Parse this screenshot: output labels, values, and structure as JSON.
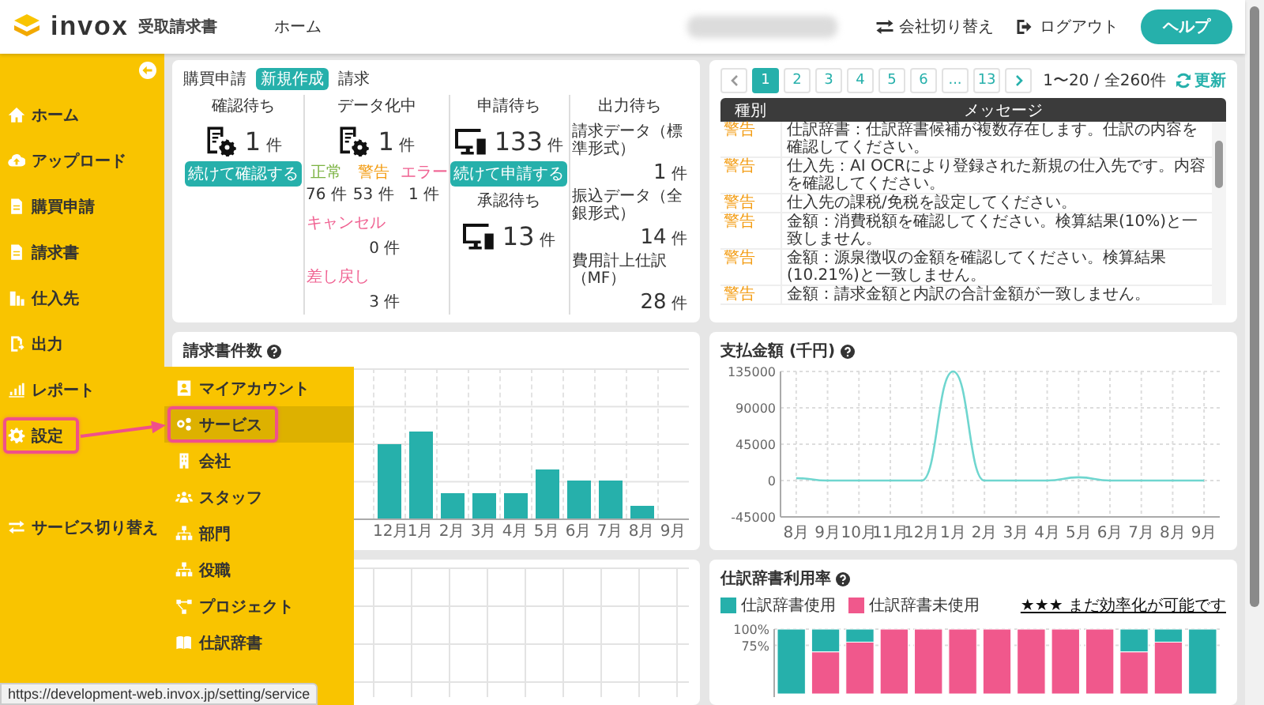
{
  "header": {
    "logo": "invox",
    "product": "受取請求書",
    "nav": [
      {
        "label": "ホーム"
      }
    ],
    "actions": [
      {
        "kind": "switch",
        "label": "会社切り替え"
      },
      {
        "kind": "logout",
        "label": "ログアウト"
      }
    ],
    "help_button": "ヘルプ"
  },
  "sidebar": {
    "items": [
      {
        "kind": "home",
        "label": "ホーム",
        "highlighted": false
      },
      {
        "kind": "upload",
        "label": "アップロード",
        "highlighted": false
      },
      {
        "kind": "doc",
        "label": "購買申請",
        "highlighted": false
      },
      {
        "kind": "doc",
        "label": "請求書",
        "highlighted": false
      },
      {
        "kind": "supplier",
        "label": "仕入先",
        "highlighted": false
      },
      {
        "kind": "output",
        "label": "出力",
        "highlighted": false
      },
      {
        "kind": "report",
        "label": "レポート",
        "highlighted": false
      },
      {
        "kind": "settings",
        "label": "設定",
        "highlighted": true
      },
      {
        "kind": "switch",
        "label": "サービス切り替え",
        "highlighted": false
      }
    ]
  },
  "submenu": {
    "items": [
      {
        "kind": "user",
        "label": "マイアカウント",
        "selected": false,
        "highlighted": false
      },
      {
        "kind": "gears",
        "label": "サービス",
        "selected": true,
        "highlighted": true
      },
      {
        "kind": "building",
        "label": "会社",
        "selected": false,
        "highlighted": false
      },
      {
        "kind": "people",
        "label": "スタッフ",
        "selected": false,
        "highlighted": false
      },
      {
        "kind": "org",
        "label": "部門",
        "selected": false,
        "highlighted": false
      },
      {
        "kind": "org",
        "label": "役職",
        "selected": false,
        "highlighted": false
      },
      {
        "kind": "project",
        "label": "プロジェクト",
        "selected": false,
        "highlighted": false
      },
      {
        "kind": "book",
        "label": "仕訳辞書",
        "selected": false,
        "highlighted": false
      }
    ]
  },
  "summary": {
    "links": [
      {
        "kind": "link",
        "label": "購買申請"
      },
      {
        "kind": "badge",
        "label": "新規作成"
      },
      {
        "kind": "link",
        "label": "請求"
      }
    ],
    "columns": [
      {
        "title": "確認待ち",
        "blocks": [
          {
            "kind": "count-doc",
            "value": "1",
            "unit": "件"
          },
          {
            "kind": "button",
            "label": "続けて確認する"
          }
        ]
      },
      {
        "title": "データ化中",
        "blocks": [
          {
            "kind": "count-doc",
            "value": "1",
            "unit": "件"
          },
          {
            "kind": "statuses",
            "items": [
              {
                "label": "正常",
                "value": "76",
                "unit": "件",
                "color": "#7cb342"
              },
              {
                "label": "警告",
                "value": "53",
                "unit": "件",
                "color": "#f39c12"
              },
              {
                "label": "エラー",
                "value": "1",
                "unit": "件",
                "color": "#f06292"
              }
            ]
          },
          {
            "kind": "sub",
            "label": "キャンセル",
            "value": "0",
            "unit": "件"
          },
          {
            "kind": "sub",
            "label": "差し戻し",
            "value": "3",
            "unit": "件"
          }
        ]
      },
      {
        "title": "申請待ち",
        "blocks": [
          {
            "kind": "count-monitor",
            "value": "133",
            "unit": "件"
          },
          {
            "kind": "button",
            "label": "続けて申請する"
          },
          {
            "kind": "subtitle",
            "label": "承認待ち"
          },
          {
            "kind": "count-monitor",
            "value": "13",
            "unit": "件"
          }
        ]
      },
      {
        "title": "出力待ち",
        "blocks": [
          {
            "kind": "output",
            "label": "請求データ（標準形式）",
            "value": "1",
            "unit": "件"
          },
          {
            "kind": "output",
            "label": "振込データ（全銀形式）",
            "value": "14",
            "unit": "件"
          },
          {
            "kind": "output",
            "label": "費用計上仕訳（MF）",
            "value": "28",
            "unit": "件"
          }
        ]
      }
    ]
  },
  "messages": {
    "pages": [
      {
        "label": "1",
        "selected": true
      },
      {
        "label": "2",
        "selected": false
      },
      {
        "label": "3",
        "selected": false
      },
      {
        "label": "4",
        "selected": false
      },
      {
        "label": "5",
        "selected": false
      },
      {
        "label": "6",
        "selected": false
      },
      {
        "label": "...",
        "selected": false
      },
      {
        "label": "13",
        "selected": false
      }
    ],
    "range": "1〜20 / 全260件",
    "refresh": "更新",
    "columns": [
      "種別",
      "メッセージ"
    ],
    "rows": [
      {
        "type": "警告",
        "message": "仕訳辞書：仕訳辞書候補が複数存在します。仕訳の内容を確認してください。"
      },
      {
        "type": "警告",
        "message": "仕入先：AI OCRにより登録された新規の仕入先です。内容を確認してください。"
      },
      {
        "type": "警告",
        "message": "仕入先の課税/免税を設定してください。"
      },
      {
        "type": "警告",
        "message": "金額：消費税額を確認してください。検算結果(10%)と一致しません。"
      },
      {
        "type": "警告",
        "message": "金額：源泉徴収の金額を確認してください。検算結果(10.21%)と一致しません。"
      },
      {
        "type": "警告",
        "message": "金額：請求金額と内訳の合計金額が一致しません。"
      }
    ]
  },
  "invoice_count": {
    "title": "請求書件数",
    "bars": [
      {
        "label": "12月",
        "level": 0.5
      },
      {
        "label": "1月",
        "level": 0.58
      },
      {
        "label": "2月",
        "level": 0.17
      },
      {
        "label": "3月",
        "level": 0.17
      },
      {
        "label": "4月",
        "level": 0.17
      },
      {
        "label": "5月",
        "level": 0.33
      },
      {
        "label": "6月",
        "level": 0.25
      },
      {
        "label": "7月",
        "level": 0.25
      },
      {
        "label": "8月",
        "level": 0.08
      },
      {
        "label": "9月",
        "level": 0
      }
    ]
  },
  "payment_amount": {
    "title": "支払金額 (千円)",
    "chart_data": {
      "type": "line",
      "categories": [
        "8月",
        "9月",
        "10月",
        "11月",
        "12月",
        "1月",
        "2月",
        "3月",
        "4月",
        "5月",
        "6月",
        "7月",
        "8月",
        "9月"
      ],
      "series": [
        {
          "color": "#6fd6cf",
          "values": [
            3000,
            0,
            0,
            0,
            0,
            135000,
            0,
            0,
            0,
            4000,
            0,
            0,
            0,
            0
          ]
        }
      ],
      "ylim": [
        -45000,
        135000
      ],
      "yticks": [
        -45000,
        0,
        45000,
        90000,
        135000
      ],
      "grid": true
    }
  },
  "dictionary_usage": {
    "title": "仕訳辞書利用率",
    "link": "★★★ まだ効率化が可能です",
    "chart_data": {
      "type": "bar",
      "stacked": true,
      "series": [
        {
          "name": "仕訳辞書使用",
          "color": "#26b0ab",
          "values": [
            1,
            0.35,
            0.2,
            0,
            0,
            0,
            0,
            0,
            0,
            0,
            0.35,
            0.2,
            1
          ]
        },
        {
          "name": "仕訳辞書未使用",
          "color": "#f0588c",
          "values": [
            0,
            0.65,
            0.8,
            1,
            1,
            1,
            1,
            1,
            1,
            1,
            0.65,
            0.8,
            0
          ]
        }
      ],
      "ylim": [
        0,
        1
      ],
      "yticks": [
        {
          "value": 1,
          "label": "100%"
        },
        {
          "value": 0.75,
          "label": "75%"
        }
      ]
    }
  },
  "status_url": "https://development-web.invox.jp/setting/service"
}
